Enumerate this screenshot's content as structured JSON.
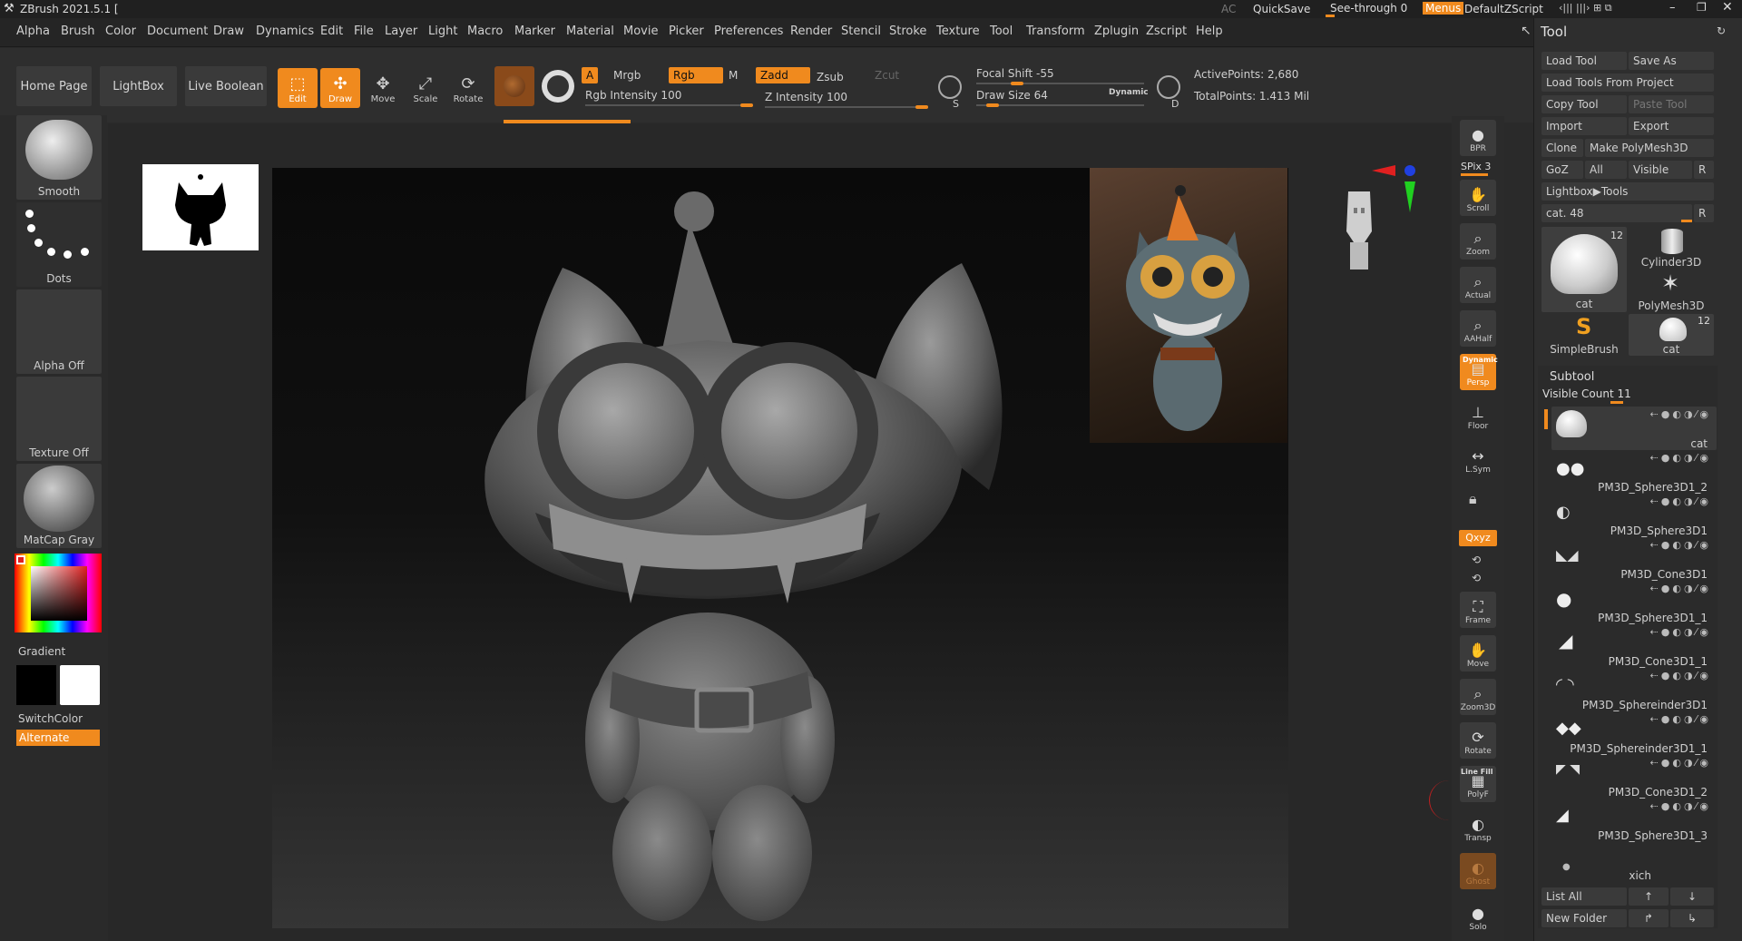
{
  "app": {
    "title": "ZBrush 2021.5.1 [",
    "ac": "AC",
    "quicksave": "QuickSave",
    "see_through": "See-through  0",
    "menus": "Menus",
    "default_script": "DefaultZScript"
  },
  "menubar": [
    "Alpha",
    "Brush",
    "Color",
    "Document",
    "Draw",
    "Dynamics",
    "Edit",
    "File",
    "Layer",
    "Light",
    "Macro",
    "Marker",
    "Material",
    "Movie",
    "Picker",
    "Preferences",
    "Render",
    "Stencil",
    "Stroke",
    "Texture",
    "Tool",
    "Transform",
    "Zplugin",
    "Zscript",
    "Help"
  ],
  "shelf": {
    "home_page": "Home Page",
    "lightbox": "LightBox",
    "live_boolean": "Live Boolean",
    "tools": [
      {
        "label": "Edit",
        "icon": "edit-icon",
        "active": true
      },
      {
        "label": "Draw",
        "icon": "draw-icon",
        "active": true
      },
      {
        "label": "Move",
        "icon": "move-icon",
        "active": false
      },
      {
        "label": "Scale",
        "icon": "scale-icon",
        "active": false
      },
      {
        "label": "Rotate",
        "icon": "rotate-icon",
        "active": false
      }
    ],
    "a_label": "A",
    "mrgb": "Mrgb",
    "rgb": "Rgb",
    "m": "M",
    "zadd": "Zadd",
    "zsub": "Zsub",
    "zcut": "Zcut",
    "rgb_intensity": "Rgb Intensity 100",
    "z_intensity": "Z Intensity 100",
    "focal_shift": "Focal Shift -55",
    "draw_size": "Draw Size 64",
    "dynamic": "Dynamic",
    "active_points": "ActivePoints: 2,680",
    "total_points": "TotalPoints: 1.413 Mil",
    "s_label": "S",
    "d_label": "D",
    "rgb_intensity_value": 100,
    "z_intensity_value": 100,
    "focal_shift_value": -55,
    "draw_size_value": 64
  },
  "left_panel": {
    "smooth": "Smooth",
    "dots": "Dots",
    "alpha_off": "Alpha Off",
    "texture_off": "Texture Off",
    "matcap": "MatCap Gray",
    "gradient": "Gradient",
    "switch_color": "SwitchColor",
    "alternate": "Alternate"
  },
  "right_toolbar": [
    {
      "label": "BPR",
      "icon": "bpr-icon"
    },
    {
      "label": "Scroll",
      "icon": "hand-icon"
    },
    {
      "label": "Zoom",
      "icon": "zoom-icon"
    },
    {
      "label": "Actual",
      "icon": "actual-icon"
    },
    {
      "label": "AAHalf",
      "icon": "aahalf-icon"
    },
    {
      "label": "Persp",
      "icon": "persp-icon"
    },
    {
      "label": "Floor",
      "icon": "floor-icon"
    },
    {
      "label": "L.Sym",
      "icon": "lsym-icon"
    },
    {
      "label": "Frame",
      "icon": "frame-icon"
    },
    {
      "label": "Move",
      "icon": "move-icon"
    },
    {
      "label": "Zoom3D",
      "icon": "zoom3d-icon"
    },
    {
      "label": "Rotate",
      "icon": "rotate-icon"
    },
    {
      "label": "PolyF",
      "icon": "polyf-icon"
    },
    {
      "label": "Transp",
      "icon": "transp-icon"
    },
    {
      "label": "Ghost",
      "icon": "ghost-icon"
    },
    {
      "label": "Solo",
      "icon": "solo-icon"
    }
  ],
  "right_toolbar_extra": {
    "spix": "SPix 3",
    "dynamic": "Dynamic",
    "xyz": "Qxyz",
    "line_fill": "Line Fill"
  },
  "tool_panel": {
    "title": "Tool",
    "load_tool": "Load Tool",
    "save_as": "Save As",
    "load_from_project": "Load Tools From Project",
    "copy_tool": "Copy Tool",
    "paste_tool": "Paste Tool",
    "import": "Import",
    "export": "Export",
    "clone": "Clone",
    "make_polymesh": "Make PolyMesh3D",
    "goz": "GoZ",
    "all": "All",
    "visible": "Visible",
    "r": "R",
    "lightbox_tools": "Lightbox▶Tools",
    "cat_slider": "cat. 48",
    "cat_slider_value": 48,
    "thumbs": [
      {
        "label": "cat",
        "count": "12"
      },
      {
        "label": "Cylinder3D",
        "count": ""
      },
      {
        "label": "PolyMesh3D",
        "count": ""
      },
      {
        "label": "SimpleBrush",
        "count": ""
      },
      {
        "label": "cat",
        "count": "12"
      }
    ],
    "subtool_title": "Subtool",
    "visible_count": "Visible Count 11",
    "subtools": [
      "cat",
      "PM3D_Sphere3D1_2",
      "PM3D_Sphere3D1",
      "PM3D_Cone3D1",
      "PM3D_Sphere3D1_1",
      "PM3D_Cone3D1_1",
      "PM3D_Sphereinder3D1",
      "PM3D_Sphereinder3D1_1",
      "PM3D_Cone3D1_2",
      "PM3D_Sphere3D1_3",
      "xich"
    ],
    "list_all": "List All",
    "new_folder": "New Folder"
  },
  "colors": {
    "accent": "#f08a1e",
    "panel": "#2e2e2e",
    "button": "#3a3a3a"
  }
}
